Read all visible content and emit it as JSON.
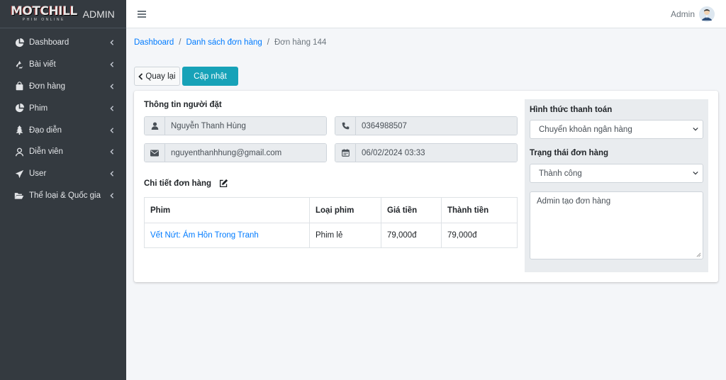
{
  "brand": {
    "logo_text": "MOTCHILL",
    "logo_sub": "PHIM ONLINE",
    "title": "ADMIN"
  },
  "sidebar": {
    "items": [
      {
        "label": "Dashboard",
        "icon": "chart-pie-icon"
      },
      {
        "label": "Bài viết",
        "icon": "recycle-icon"
      },
      {
        "label": "Đơn hàng",
        "icon": "shopping-bag-icon"
      },
      {
        "label": "Phim",
        "icon": "chart-pie-icon"
      },
      {
        "label": "Đạo diễn",
        "icon": "tree-icon"
      },
      {
        "label": "Diễn viên",
        "icon": "user-outline-icon"
      },
      {
        "label": "User",
        "icon": "paper-plane-icon"
      },
      {
        "label": "Thể loại & Quốc gia",
        "icon": "folder-open-icon"
      }
    ]
  },
  "topbar": {
    "admin_name": "Admin"
  },
  "breadcrumb": {
    "items": [
      "Dashboard",
      "Danh sách đơn hàng"
    ],
    "active": "Đơn hàng 144"
  },
  "actions": {
    "back_label": "Quay lại",
    "update_label": "Cập nhật"
  },
  "customer": {
    "title": "Thông tin người đặt",
    "name": "Nguyễn Thanh Hùng",
    "phone": "0364988507",
    "email": "nguyenthanhhung@gmail.com",
    "date": "06/02/2024 03:33"
  },
  "order_detail": {
    "title": "Chi tiết đơn hàng",
    "columns": [
      "Phim",
      "Loại phim",
      "Giá tiền",
      "Thành tiền"
    ],
    "rows": [
      {
        "film": "Vết Nứt: Ám Hồn Trong Tranh",
        "type": "Phim lẻ",
        "price": "79,000đ",
        "total": "79,000đ"
      }
    ]
  },
  "payment": {
    "method_label": "Hình thức thanh toán",
    "method_value": "Chuyển khoản ngân hàng",
    "status_label": "Trạng thái đơn hàng",
    "status_value": "Thành công",
    "note": "Admin tạo đơn hàng"
  },
  "colors": {
    "sidebar_bg": "#343a40",
    "link": "#007bff",
    "update_button": "#17a2b8"
  }
}
